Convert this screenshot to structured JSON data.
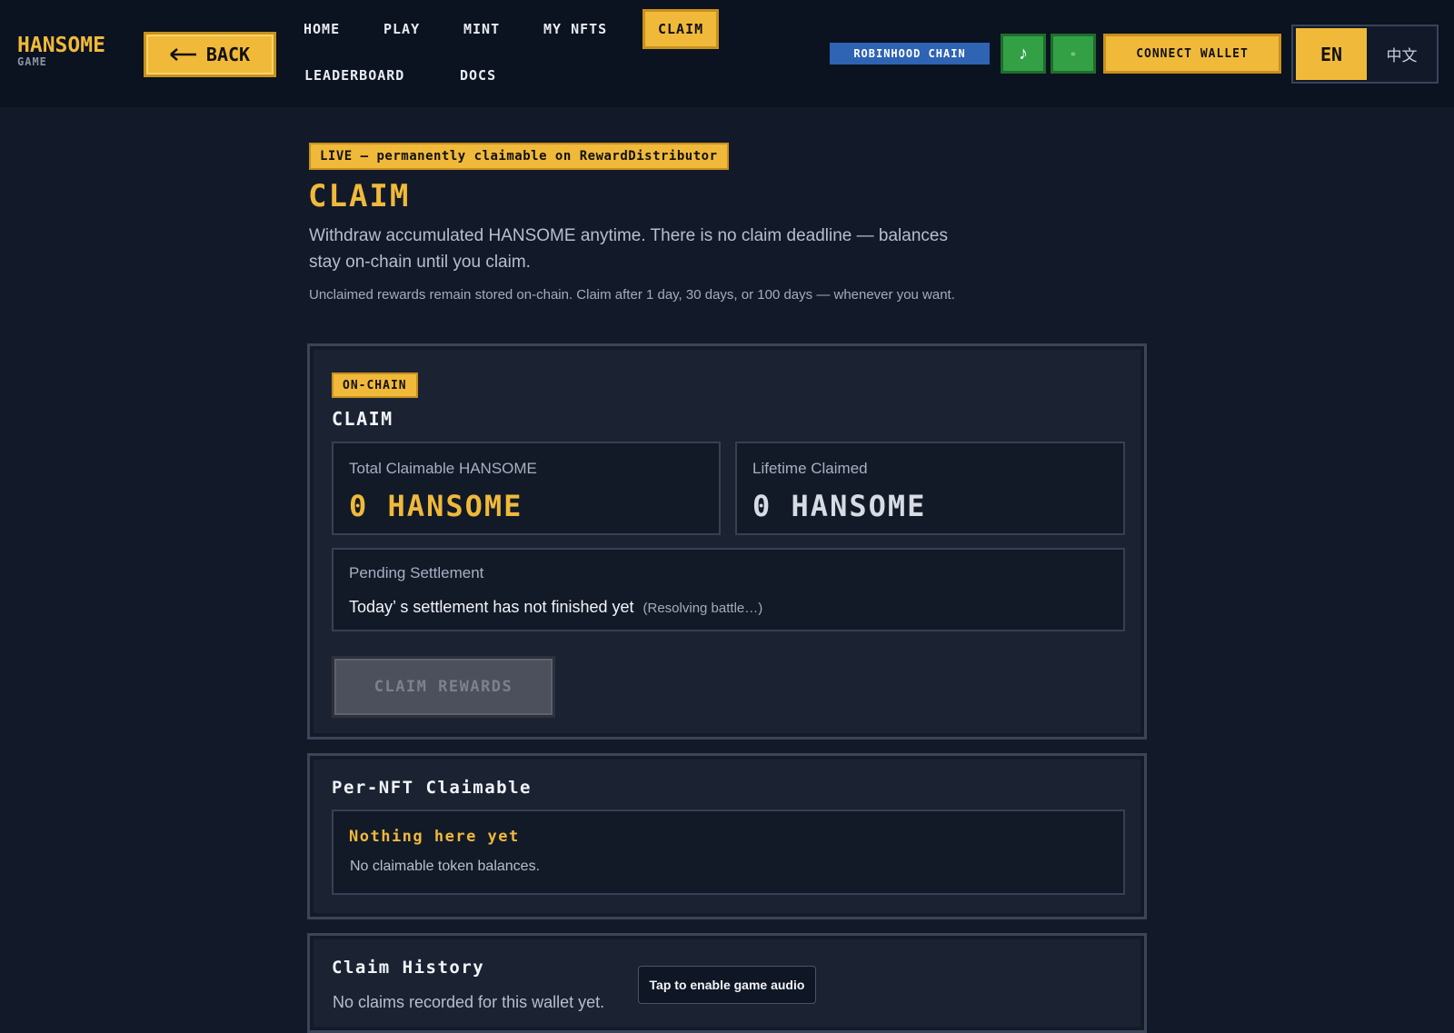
{
  "header": {
    "logo_main": "HANSOME",
    "logo_sub": "GAME",
    "back_label": "BACK",
    "back_icon": "arrow-left-icon",
    "nav": [
      {
        "label": "HOME"
      },
      {
        "label": "PLAY"
      },
      {
        "label": "MINT"
      },
      {
        "label": "MY NFTS"
      },
      {
        "label": "CLAIM",
        "active": true
      },
      {
        "label": "LEADERBOARD"
      },
      {
        "label": "DOCS"
      }
    ],
    "chain_label": "ROBINHOOD CHAIN",
    "music_icon": "♪",
    "sfx_icon": "▫",
    "connect_label": "CONNECT WALLET",
    "lang_en": "EN",
    "lang_zh": "中文"
  },
  "page": {
    "live_badge": "LIVE — permanently claimable on RewardDistributor",
    "title": "CLAIM",
    "intro": "Withdraw accumulated HANSOME anytime. There is no claim deadline — balances stay on-chain until you claim.",
    "intro_small": "Unclaimed rewards remain stored on-chain. Claim after 1 day, 30 days, or 100 days — whenever you want."
  },
  "claim_panel": {
    "tag": "ON-CHAIN",
    "heading": "CLAIM",
    "total_label": "Total Claimable HANSOME",
    "total_value": "0 HANSOME",
    "lifetime_label": "Lifetime Claimed",
    "lifetime_value": "0 HANSOME",
    "pending_label": "Pending Settlement",
    "pending_text": "Today’ s settlement has not finished yet",
    "pending_note": "(Resolving battle…)",
    "claim_button": "CLAIM REWARDS"
  },
  "per_nft": {
    "heading": "Per-NFT Claimable",
    "empty_title": "Nothing here yet",
    "empty_text": "No claimable token balances."
  },
  "history": {
    "heading": "Claim History",
    "empty_text": "No claims recorded for this wallet yet."
  },
  "toast": {
    "label": "Tap to enable game audio"
  },
  "colors": {
    "accent": "#f0b93a",
    "background": "#121a2a",
    "header_bg": "#0b1220",
    "panel_bg": "#1b2333",
    "chain_blue": "#2f63b3",
    "audio_green": "#33a046"
  }
}
